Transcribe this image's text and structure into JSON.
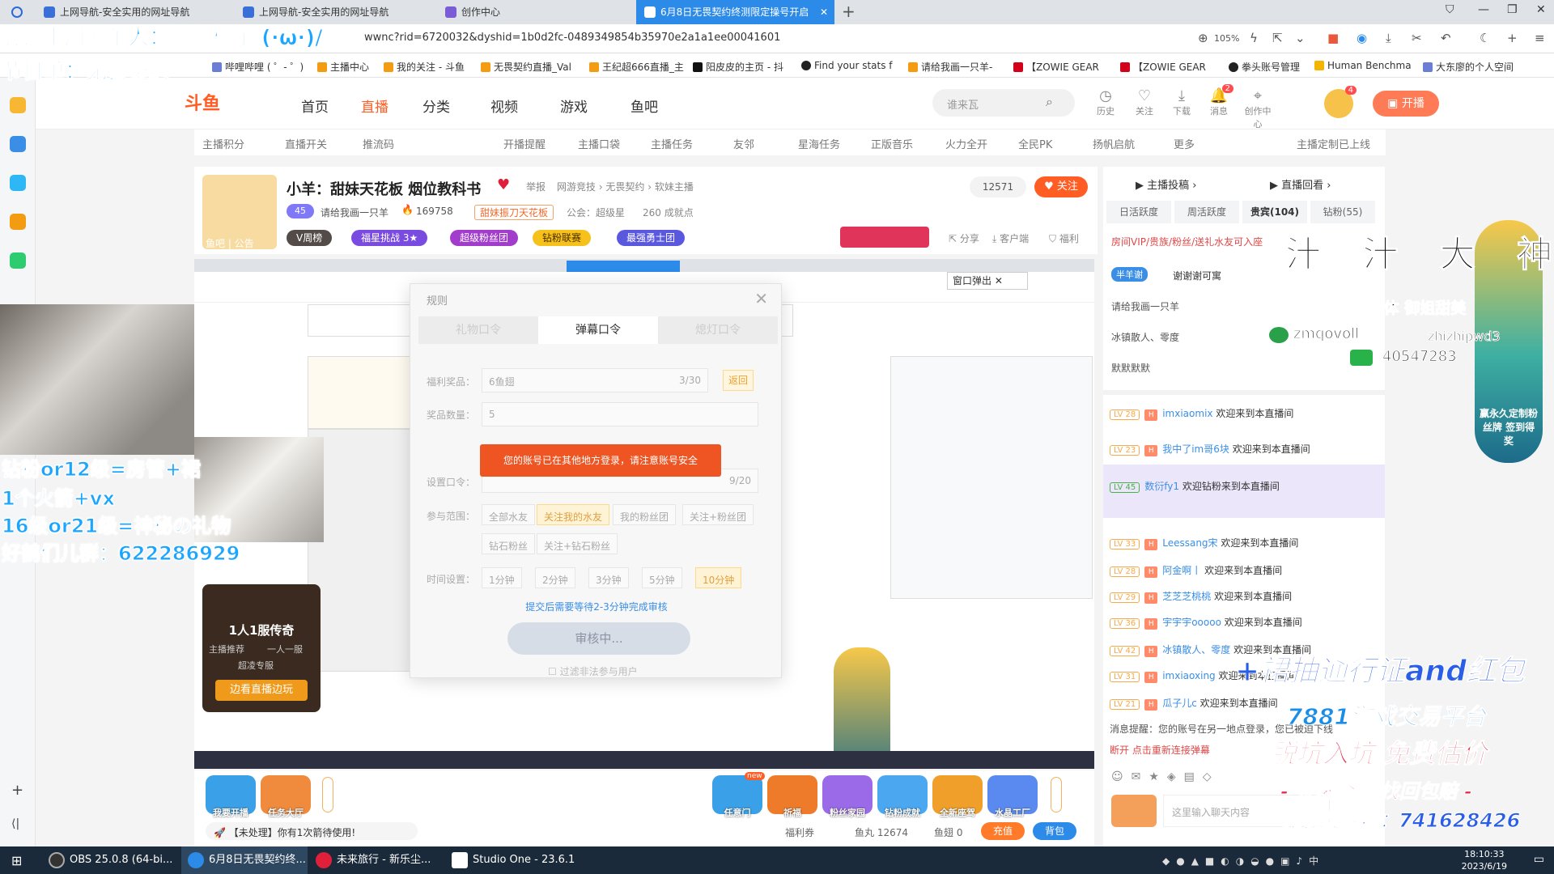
{
  "browser": {
    "tabs": [
      {
        "label": "上网导航-安全实用的网址导航"
      },
      {
        "label": "上网导航-安全实用的网址导航"
      },
      {
        "label": "创作中心"
      },
      {
        "label": "6月8日无畏契约终测限定操号开启"
      }
    ],
    "url": "wwnc?rid=6720032&dyshid=1b0d2fc-0489349854b35970e2a1a1ee00041601",
    "zoom": "105%",
    "bookmarks": [
      "哔哩哔哩 ( ゜- ゜)",
      "主播中心",
      "我的关注 - 斗鱼",
      "无畏契约直播_Val",
      "王纪超666直播_主",
      "阳皮皮的主页 - 抖",
      "Find your stats f",
      "请给我画一只羊-",
      "【ZOWIE GEAR",
      "【ZOWIE GEAR",
      "拳头账号管理",
      "Human Benchma",
      "大东廖的个人空间"
    ]
  },
  "douyu": {
    "logo": "斗鱼",
    "nav": [
      "首页",
      "直播",
      "分类",
      "视频",
      "游戏",
      "鱼吧"
    ],
    "search_placeholder": "谁来瓦",
    "header_icons": [
      {
        "name": "history-icon",
        "label": "历史"
      },
      {
        "name": "heart-icon",
        "label": "关注"
      },
      {
        "name": "download-icon",
        "label": "下载"
      },
      {
        "name": "bell-icon",
        "label": "消息",
        "badge": "2"
      },
      {
        "name": "location-icon",
        "label": "创作中心"
      }
    ],
    "avatar_badge": "4",
    "kaibo": "开播",
    "subnav": [
      "主播积分",
      "直播开关",
      "推流码",
      "开播提醒",
      "主播口袋",
      "主播任务",
      "友邻",
      "星海任务",
      "正版音乐",
      "火力全开",
      "全民PK",
      "扬帆启航",
      "更多",
      "主播定制已上线"
    ]
  },
  "room": {
    "title": "小羊：甜妹天花板 烟位教科书",
    "report": "举报",
    "category": "网游竞技 › 无畏契约 › 软妹主播",
    "level": "45",
    "streamer": "请给我画一只羊",
    "hot": "169758",
    "union": "甜妹振刀天花板",
    "guild": "公会：超级星",
    "achievements": "260 成就点",
    "followers": "12571",
    "follow": "关注",
    "pills": [
      "V周榜",
      "福星挑战 3★",
      "超级粉丝团",
      "钻粉联赛",
      "最强勇士团"
    ],
    "actions": [
      "分享",
      "客户端",
      "福利"
    ],
    "fishbar": "鱼吧 | 公告"
  },
  "dialog": {
    "title": "规则",
    "tabs": [
      "礼物口令",
      "弹幕口令",
      "熄灯口令"
    ],
    "fields": [
      {
        "label": "福利奖品：",
        "value": "6鱼翅",
        "count": "3/30",
        "btn": "返回"
      },
      {
        "label": "奖品数量：",
        "value": "5"
      },
      {
        "label": "设置口令：",
        "count": "9/20"
      }
    ],
    "toast": "您的账号已在其他地方登录，请注意账号安全",
    "range_label": "参与范围：",
    "ranges": [
      "全部水友",
      "关注我的水友",
      "我的粉丝团",
      "关注+粉丝团",
      "钻石粉丝",
      "关注+钻石粉丝"
    ],
    "time_label": "时间设置：",
    "times": [
      "1分钟",
      "2分钟",
      "3分钟",
      "5分钟",
      "10分钟"
    ],
    "tip": "提交后需要等待2-3分钟完成审核",
    "submit": "审核中...",
    "filter": "过滤非法参与用户"
  },
  "toolbar": {
    "gifts_left": [
      "我要开播",
      "任务大厅"
    ],
    "gifts_right": [
      "任意门",
      "祈福",
      "粉丝家园",
      "钻粉成就",
      "全新座驾",
      "水晶工厂"
    ],
    "new_badge": "new",
    "unprocessed": "【未处理】你有1次箭待使用!",
    "coupon": "福利券",
    "fishball": "鱼丸 12674",
    "fishfin": "鱼翅 0",
    "recharge": "充值",
    "bag": "背包"
  },
  "rpanel": {
    "top_links": [
      "主播投稿",
      "直播回看"
    ],
    "tabs": [
      "日活跃度",
      "周活跃度",
      "贵宾(104)",
      "钻粉(55)"
    ],
    "vip_notice": "房间VIP/贵族/粉丝/送礼水友可入座",
    "static_rows": [
      "半羊谢",
      "谢谢谢可寓",
      "请给我画一只羊",
      "冰镇散人、零度",
      "默默默默"
    ],
    "messages": [
      {
        "lv": "LV 28",
        "name": "imxiaomix",
        "text": "欢迎来到本直播间"
      },
      {
        "lv": "LV 23",
        "name": "我中了im哥6块",
        "text": "欢迎来到本直播间"
      },
      {
        "lv": "LV 45",
        "name": "数衍fy1",
        "text": "欢迎钻粉来到本直播间"
      },
      {
        "lv": "LV 33",
        "name": "Leessang宋",
        "text": "欢迎来到本直播间"
      },
      {
        "lv": "LV 28",
        "name": "阿金啊丨",
        "text": "欢迎来到本直播间"
      },
      {
        "lv": "LV 29",
        "name": "芝芝芝桃桃",
        "text": "欢迎来到本直播间"
      },
      {
        "lv": "LV 36",
        "name": "宇宇宇ooooo",
        "text": "欢迎来到本直播间"
      },
      {
        "lv": "LV 42",
        "name": "冰镇散人、零度",
        "text": "欢迎来到本直播间"
      },
      {
        "lv": "LV 31",
        "name": "imxiaoxing",
        "text": "欢迎来到本直播间"
      },
      {
        "lv": "LV 21",
        "name": "瓜子儿c",
        "text": "欢迎来到本直播间"
      }
    ],
    "system_msg": "消息提醒：您的账号在另一地点登录，您已被迫下线",
    "system_reconnect": "断开 点击重新连接弹幕",
    "chat_placeholder": "这里输入聊天内容",
    "deco": "赢永久定制粉丝牌 签到得奖"
  },
  "overlay": {
    "line1": "感谢上周慕羊人：捕捉橘子 (·ω·)/",
    "line2": "节目单：无畏契约",
    "rules": [
      "钻粉or12级=房管+裙",
      "1个火箭+vx",
      "16级or21级=神秘の礼物",
      "好鹤们儿群：622286929"
    ],
    "sign_title": "汁 汁 大 神",
    "sign_sub": "赋能大神 线下实体 御姐甜美",
    "sign_qq": "zmqovoll",
    "sign_wx": "zhizhipwd3",
    "sign_num": "40547283",
    "promo1": "+裙抽通行证and红包",
    "promo2": "7881游戏交易平台",
    "promo3": "脱坑入坑 免费估价",
    "promo4": "- 签署合同 找回包赔 -",
    "promo5": "无畏契约群：741628426",
    "game_title": "1人1服传奇",
    "game_tags": [
      "主播推荐",
      "一人一服",
      "超凌专服"
    ],
    "game_btn": "边看直播边玩"
  },
  "taskbar": {
    "items": [
      "OBS 25.0.8 (64-bi...",
      "6月8日无畏契约终...",
      "未来旅行 - 新乐尘...",
      "Studio One - 23.6.1"
    ],
    "time": "18:10:33",
    "date": "2023/6/19"
  },
  "colors": {
    "brand": "#ff5d23",
    "accent": "#2c8ae8",
    "overlay_blue": "#1aa6ff"
  }
}
